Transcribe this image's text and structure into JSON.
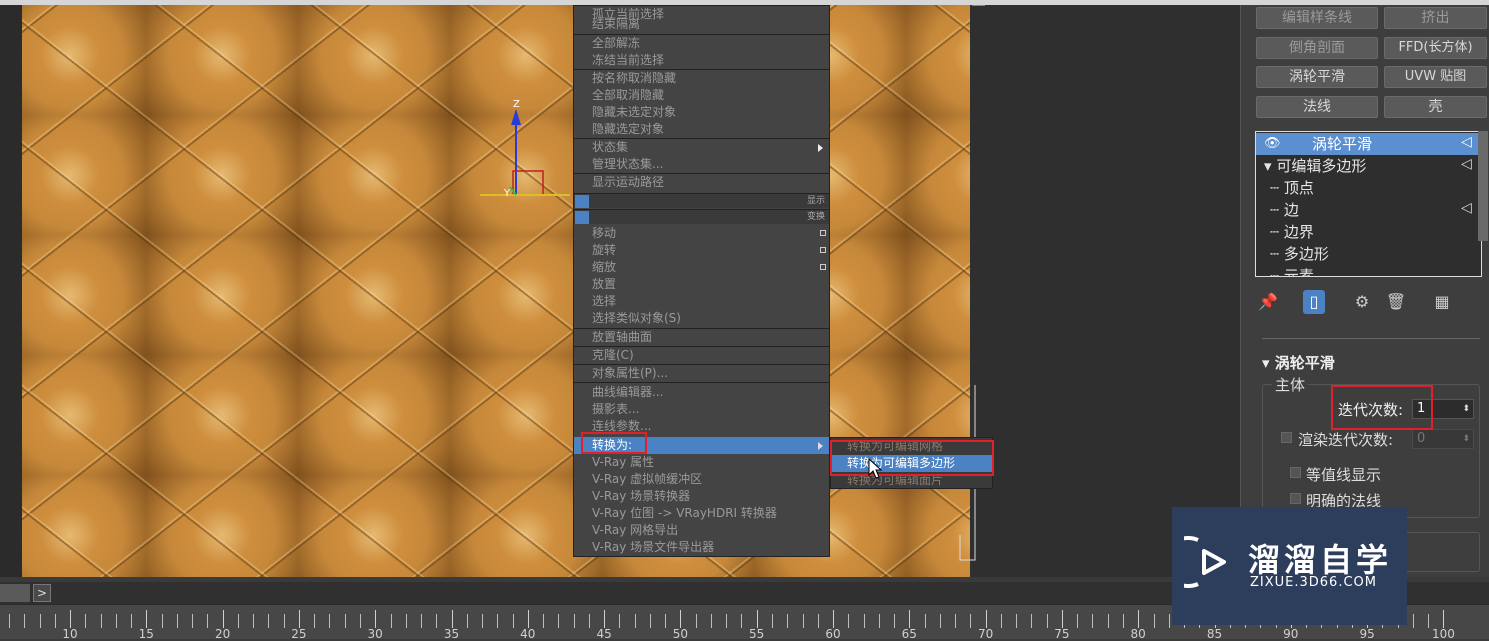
{
  "context_menu": {
    "items_top": [
      {
        "label": "孤立当前选择"
      },
      {
        "label": "结束隔离"
      },
      {
        "label": "全部解冻"
      },
      {
        "label": "冻结当前选择"
      },
      {
        "label": "按名称取消隐藏"
      },
      {
        "label": "全部取消隐藏"
      },
      {
        "label": "隐藏未选定对象"
      },
      {
        "label": "隐藏选定对象"
      },
      {
        "label": "状态集"
      },
      {
        "label": "管理状态集..."
      },
      {
        "label": "显示运动路径"
      }
    ],
    "quad_labels": {
      "display": "显示",
      "transform": "变换"
    },
    "items_bottom": [
      {
        "label": "移动"
      },
      {
        "label": "旋转"
      },
      {
        "label": "缩放"
      },
      {
        "label": "放置"
      },
      {
        "label": "选择"
      },
      {
        "label": "选择类似对象(S)"
      },
      {
        "label": "放置轴曲面"
      },
      {
        "label": "克隆(C)"
      },
      {
        "label": "对象属性(P)..."
      },
      {
        "label": "曲线编辑器..."
      },
      {
        "label": "摄影表..."
      },
      {
        "label": "连线参数..."
      },
      {
        "label": "转换为:"
      },
      {
        "label": "V-Ray 属性"
      },
      {
        "label": "V-Ray 虚拟帧缓冲区"
      },
      {
        "label": "V-Ray 场景转换器"
      },
      {
        "label": "V-Ray 位图 -> VRayHDRI 转换器"
      },
      {
        "label": "V-Ray 网格导出"
      },
      {
        "label": "V-Ray 场景文件导出器"
      }
    ],
    "submenu": [
      {
        "label": "转换为可编辑网格"
      },
      {
        "label": "转换为可编辑多边形"
      },
      {
        "label": "转换为可编辑面片"
      }
    ]
  },
  "right_panel": {
    "modifier_buttons": [
      "编辑样条线",
      "挤出",
      "倒角剖面",
      "FFD(长方体)",
      "涡轮平滑",
      "UVW 贴图",
      "法线",
      "壳"
    ],
    "stack": {
      "top": "涡轮平滑",
      "base": "可编辑多边形",
      "sub": [
        "顶点",
        "边",
        "边界",
        "多边形",
        "元素"
      ]
    },
    "rollout": {
      "title": "涡轮平滑",
      "group": "主体",
      "iterations_label": "迭代次数:",
      "iterations_value": "1",
      "render_iters_label": "渲染迭代次数:",
      "render_iters_value": "0",
      "isoline_label": "等值线显示",
      "explicit_normals_label": "明确的法线"
    }
  },
  "timeline": {
    "ticks": [
      "10",
      "15",
      "20",
      "25",
      "30",
      "35",
      "40",
      "45",
      "50",
      "55",
      "60",
      "65",
      "70",
      "75",
      "80",
      "85",
      "90",
      "95",
      "100"
    ]
  },
  "watermark": {
    "title": "溜溜自学",
    "url": "ZIXUE.3D66.COM"
  },
  "gizmo": {
    "axis_z": "Z",
    "axis_y": "Y"
  },
  "colors": {
    "highlight": "#4a82c4",
    "annotation": "#e0202a"
  }
}
